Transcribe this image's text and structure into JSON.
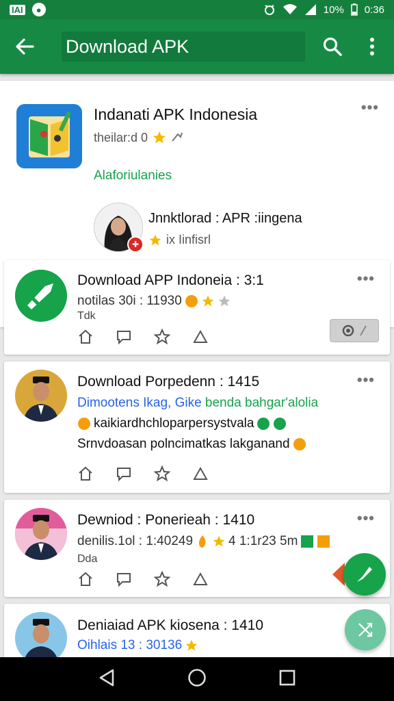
{
  "status": {
    "left_badge": "IAI",
    "left_icon": "circle-badge-icon",
    "battery": "10%",
    "time": "0:36"
  },
  "appbar": {
    "title": "Download APK"
  },
  "featured": {
    "title": "Indanati APK Indonesia",
    "subtitle": "theilar:d 0",
    "link": "Alaforiulanies",
    "author_name": "Jnnktlorad : APR :iingena",
    "author_meta": "ix Iinfisrl"
  },
  "cards": [
    {
      "title": "Download APP Indoneia : 3:1",
      "line1": "notilas 30i : 11930",
      "line2": "Tdk"
    },
    {
      "title": "Download Porpedenn : 1415",
      "line1": "Dimootens Ikag, Gike benda bahgar'alolia",
      "line1_green": "benda bahgar'alolia",
      "line2": "kaikiardhchloparpersystvala",
      "line3": "Srnvdoasan polncimatkas lakganand"
    },
    {
      "title": "Dewniod : Ponerieah : 1410",
      "line1": "denilis.1ol : 1:40249",
      "line1_b": "4 1:1r23 5m",
      "line2": "Dda"
    },
    {
      "title": "Deniaiad APK kiosena : 1410",
      "line1": "Oihlais 13 : 30136"
    }
  ],
  "colors": {
    "primary": "#168a45",
    "status": "#15803d",
    "accent": "#16a34a",
    "link_blue": "#2563eb",
    "star": "#f5b800"
  }
}
